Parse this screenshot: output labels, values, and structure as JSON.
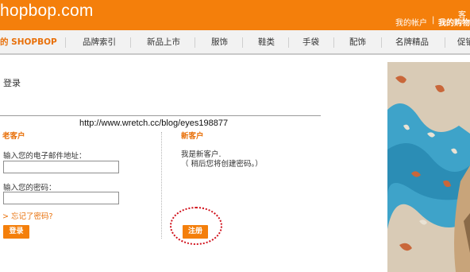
{
  "header": {
    "logo_text": "hopbop.com",
    "top_right_cut": "客",
    "account_link": "我的帐户",
    "separator": "|",
    "cart_link": "我的购物"
  },
  "nav": {
    "items": [
      {
        "label": "的 SHOPBOP"
      },
      {
        "label": "品牌索引"
      },
      {
        "label": "新品上市"
      },
      {
        "label": "服饰"
      },
      {
        "label": "鞋类"
      },
      {
        "label": "手袋"
      },
      {
        "label": "配饰"
      },
      {
        "label": "名牌精品"
      },
      {
        "label": "促销"
      }
    ]
  },
  "page": {
    "title": "登录",
    "watermark_url": "http://www.wretch.cc/blog/eyes198877"
  },
  "returning": {
    "heading": "老客户",
    "email_label": "输入您的电子邮件地址：",
    "email_value": "",
    "password_label": "输入您的密码：",
    "password_value": "",
    "forgot_link": "> 忘记了密码?",
    "login_button": "登录"
  },
  "new_customer": {
    "heading": "新客户",
    "line1": "我是新客户.",
    "line2": "（ 稍后您将创建密码。）",
    "register_button": "注册"
  },
  "colors": {
    "brand_orange": "#f47f0b",
    "heading_orange": "#e8700a",
    "annotation_red": "#d1101b",
    "nav_background": "#f2f2f2"
  }
}
